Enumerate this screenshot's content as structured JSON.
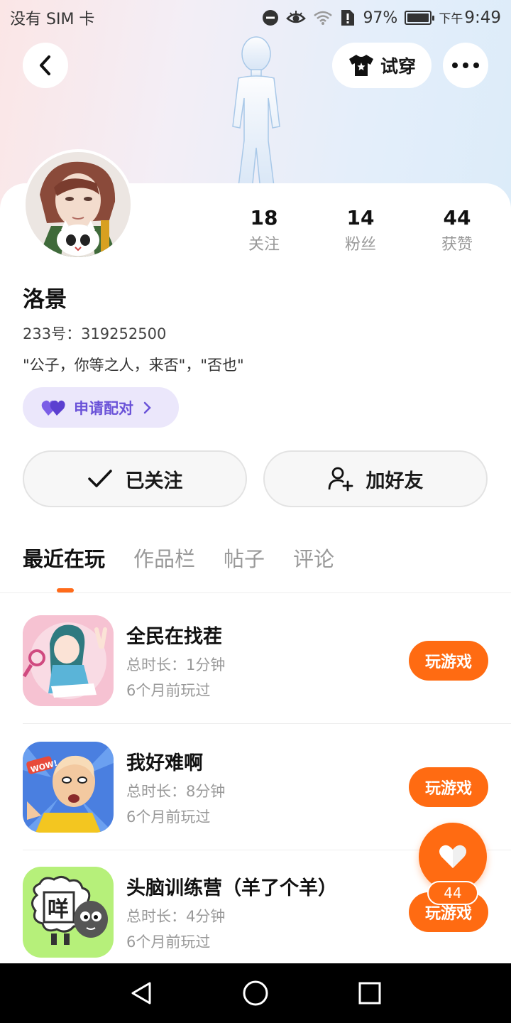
{
  "status_bar": {
    "carrier": "没有 SIM 卡",
    "battery_percent": "97%",
    "ampm": "下午",
    "time": "9:49"
  },
  "header": {
    "try_on_label": "试穿"
  },
  "profile": {
    "stats": [
      {
        "num": "18",
        "label": "关注"
      },
      {
        "num": "14",
        "label": "粉丝"
      },
      {
        "num": "44",
        "label": "获赞"
      }
    ],
    "username": "洛景",
    "uid": "233号：319252500",
    "bio": "\"公子，你等之人，来否\"，\"否也\"",
    "pair_label": "申请配对",
    "follow_label": "已关注",
    "add_friend_label": "加好友"
  },
  "tabs": [
    "最近在玩",
    "作品栏",
    "帖子",
    "评论"
  ],
  "games": [
    {
      "name": "全民在找茬",
      "duration": "总时长：1分钟",
      "when": "6个月前玩过",
      "play": "玩游戏"
    },
    {
      "name": "我好难啊",
      "duration": "总时长：8分钟",
      "when": "6个月前玩过",
      "play": "玩游戏"
    },
    {
      "name": "头脑训练营（羊了个羊）",
      "duration": "总时长：4分钟",
      "when": "6个月前玩过",
      "play": "玩游戏"
    }
  ],
  "game_icon_text": {
    "wow": "WOW!",
    "sheep_char": "咩"
  },
  "fab": {
    "count": "44"
  },
  "colors": {
    "accent": "#ff6b12",
    "pair_bg": "#ebe7fb",
    "pair_fg": "#6a52d8"
  }
}
